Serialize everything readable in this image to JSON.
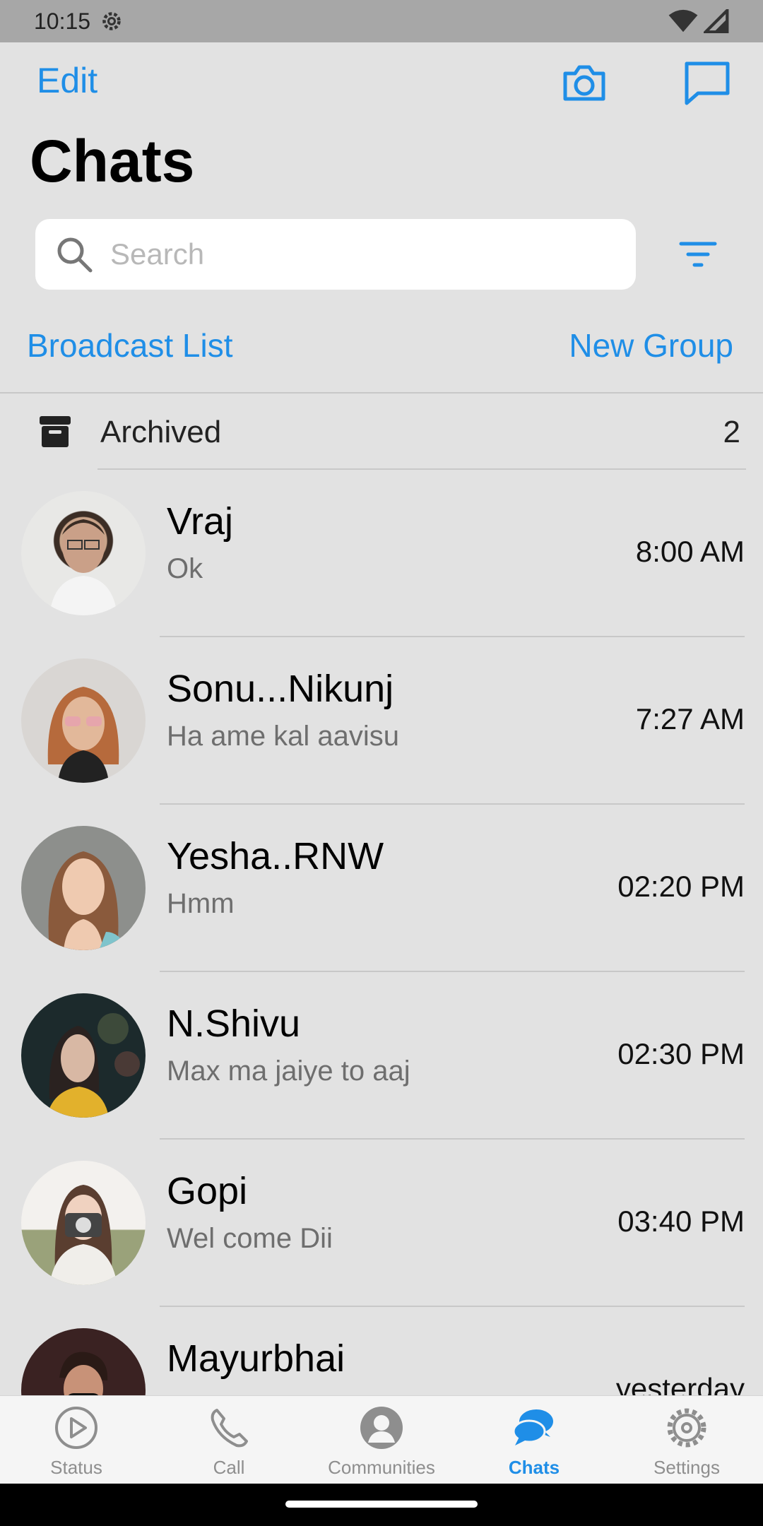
{
  "status_bar": {
    "time": "10:15"
  },
  "header": {
    "edit_label": "Edit",
    "title": "Chats",
    "accent": "#1f8ee7"
  },
  "search": {
    "placeholder": "Search"
  },
  "links": {
    "broadcast": "Broadcast List",
    "new_group": "New Group"
  },
  "archived": {
    "label": "Archived",
    "count": "2"
  },
  "chats": [
    {
      "name": "Vraj",
      "message": "Ok",
      "time": "8:00 AM"
    },
    {
      "name": "Sonu...Nikunj",
      "message": "Ha ame kal aavisu",
      "time": "7:27 AM"
    },
    {
      "name": "Yesha..RNW",
      "message": "Hmm",
      "time": "02:20 PM"
    },
    {
      "name": "N.Shivu",
      "message": "Max ma jaiye to aaj",
      "time": "02:30 PM"
    },
    {
      "name": "Gopi",
      "message": "Wel come Dii",
      "time": "03:40 PM"
    },
    {
      "name": "Mayurbhai",
      "message": "",
      "time": "yesterday"
    }
  ],
  "tabs": [
    {
      "label": "Status",
      "icon": "play-circle-icon"
    },
    {
      "label": "Call",
      "icon": "phone-icon"
    },
    {
      "label": "Communities",
      "icon": "person-circle-icon"
    },
    {
      "label": "Chats",
      "icon": "chat-bubbles-icon",
      "active": true
    },
    {
      "label": "Settings",
      "icon": "gear-icon"
    }
  ]
}
